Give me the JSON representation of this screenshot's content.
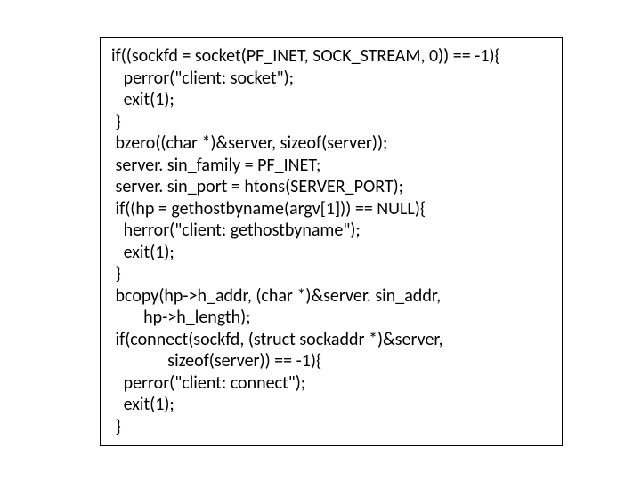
{
  "code": {
    "lines": [
      "if((sockfd = socket(PF_INET, SOCK_STREAM, 0)) == -1){",
      "   perror(\"client: socket\");",
      "   exit(1);",
      " }",
      " bzero((char *)&server, sizeof(server));",
      " server. sin_family = PF_INET;",
      " server. sin_port = htons(SERVER_PORT);",
      " if((hp = gethostbyname(argv[1])) == NULL){",
      "   herror(\"client: gethostbyname\");",
      "   exit(1);",
      " }",
      " bcopy(hp->h_addr, (char *)&server. sin_addr,",
      "        hp->h_length);",
      " if(connect(sockfd, (struct sockaddr *)&server,",
      "              sizeof(server)) == -1){",
      "   perror(\"client: connect\");",
      "   exit(1);",
      " }"
    ]
  }
}
